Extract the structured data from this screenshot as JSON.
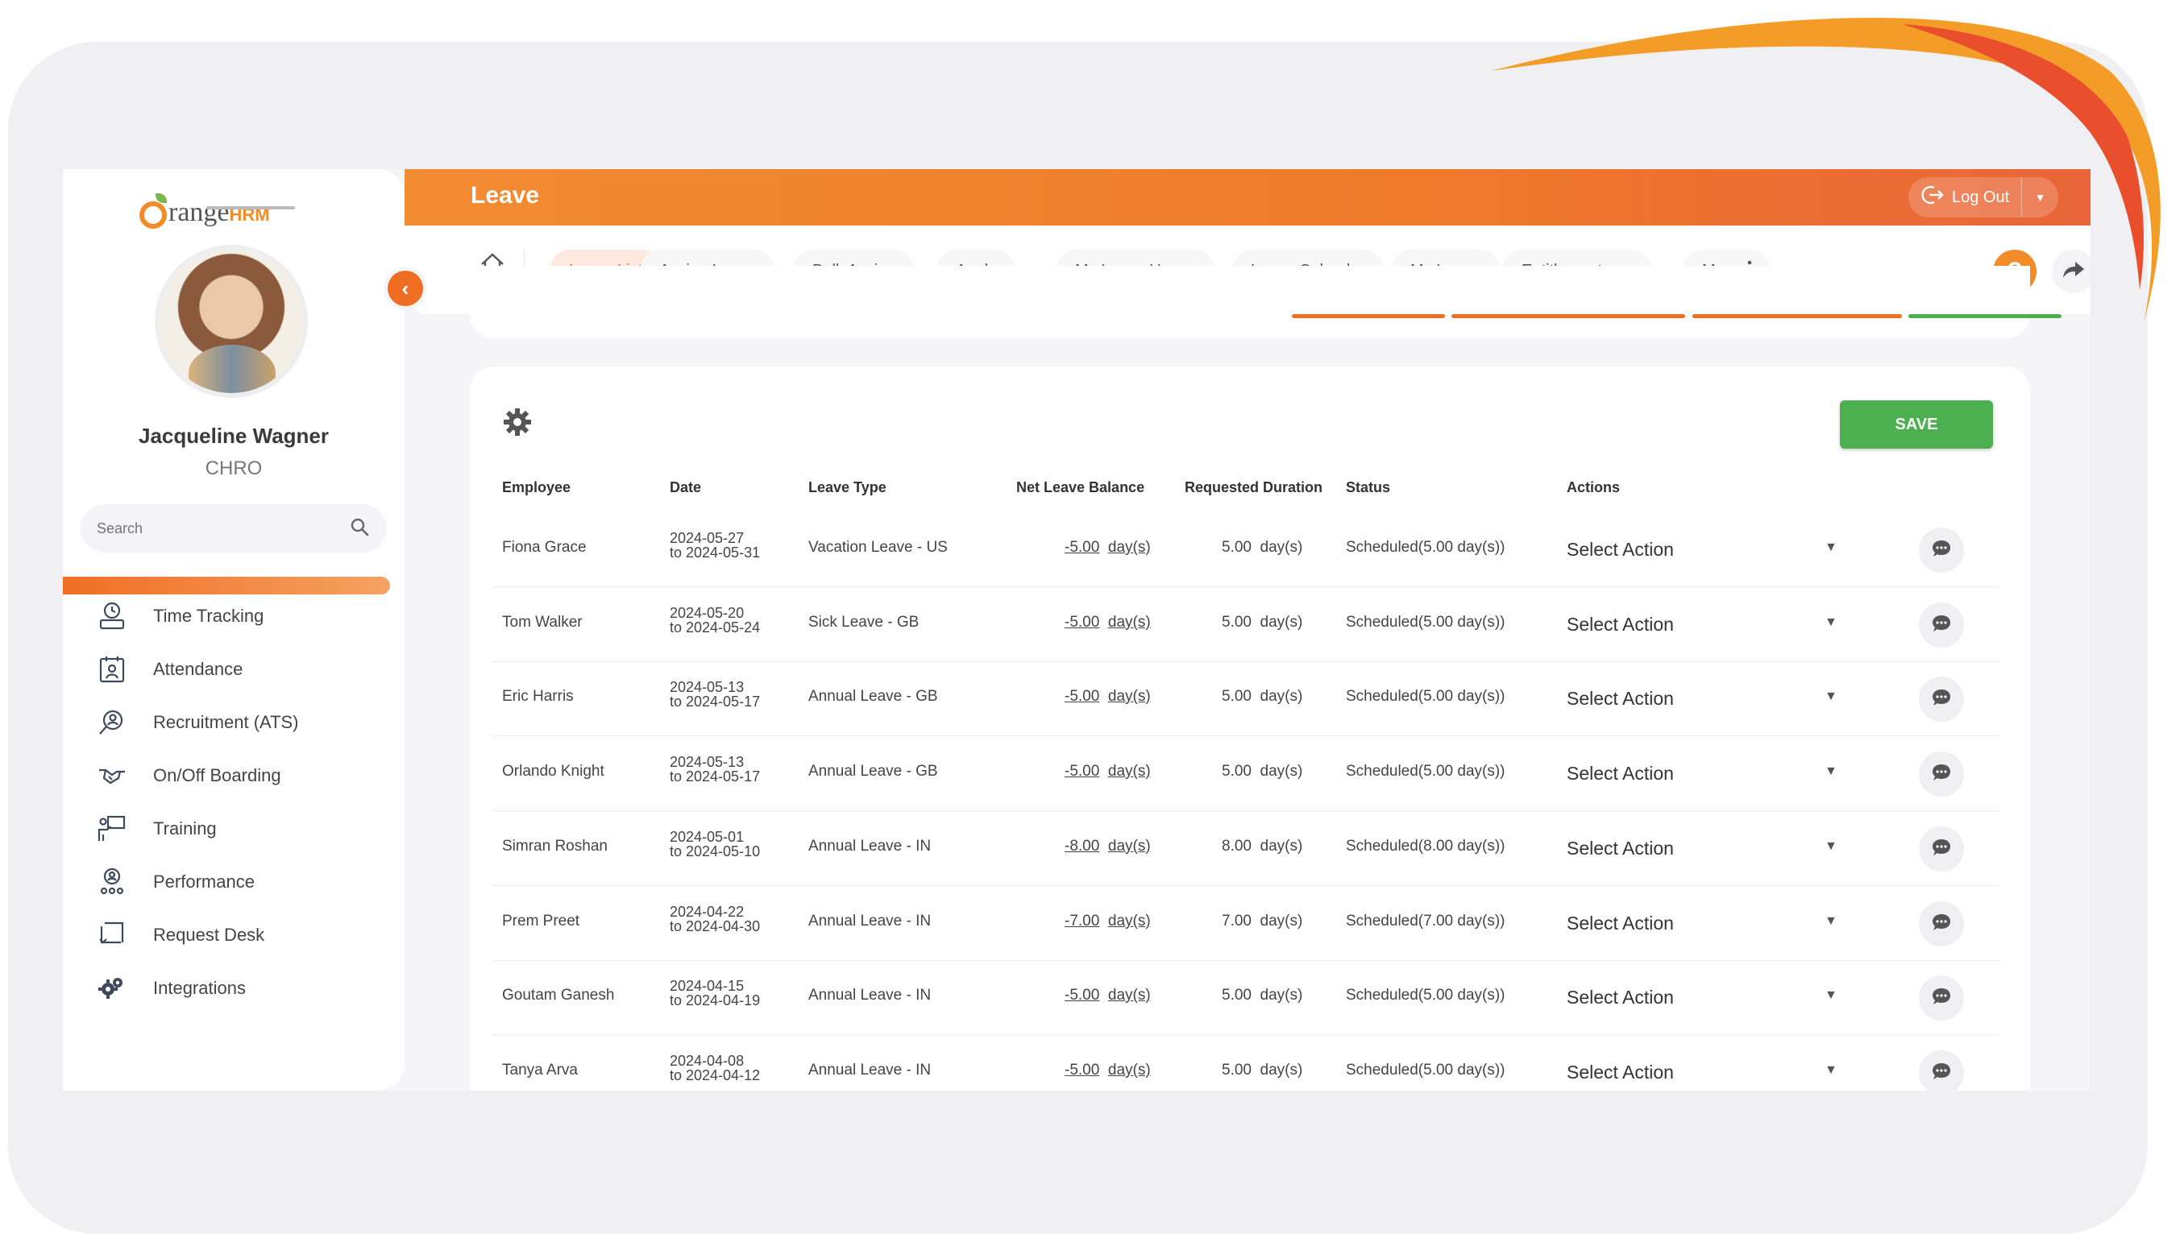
{
  "app": {
    "logo_text": "range",
    "logo_sub": "HRM",
    "module_title": "Leave",
    "logout_label": "Log Out"
  },
  "user": {
    "name": "Jacqueline Wagner",
    "role": "CHRO"
  },
  "search": {
    "placeholder": "Search"
  },
  "sidebar": {
    "items": [
      {
        "label": "Time Tracking",
        "icon": "clock-user-icon"
      },
      {
        "label": "Attendance",
        "icon": "attendance-icon"
      },
      {
        "label": "Recruitment (ATS)",
        "icon": "recruitment-icon"
      },
      {
        "label": "On/Off Boarding",
        "icon": "handshake-icon"
      },
      {
        "label": "Training",
        "icon": "training-icon"
      },
      {
        "label": "Performance",
        "icon": "performance-icon"
      },
      {
        "label": "Request Desk",
        "icon": "request-desk-icon"
      },
      {
        "label": "Integrations",
        "icon": "integrations-icon"
      }
    ]
  },
  "tabs": [
    {
      "label": "Leave List",
      "active": true
    },
    {
      "label": "Assign Leave"
    },
    {
      "label": "Bulk Assign"
    },
    {
      "label": "Apply"
    },
    {
      "label": "My Leave Usage"
    },
    {
      "label": "Leave Calendar"
    },
    {
      "label": "My Leave"
    },
    {
      "label": "Entitlements"
    },
    {
      "label": "More"
    }
  ],
  "table": {
    "save_label": "SAVE",
    "headers": {
      "employee": "Employee",
      "date": "Date",
      "leave_type": "Leave Type",
      "net_balance": "Net Leave Balance",
      "requested": "Requested Duration",
      "status": "Status",
      "actions": "Actions"
    },
    "rows": [
      {
        "employee": "Fiona Grace",
        "date_from": "2024-05-27",
        "date_to": "to 2024-05-31",
        "leave_type": "Vacation Leave - US",
        "balance": "-5.00",
        "balance_unit": "day(s)",
        "duration": "5.00  day(s)",
        "status": "Scheduled(5.00 day(s))",
        "action": "Select Action"
      },
      {
        "employee": "Tom Walker",
        "date_from": "2024-05-20",
        "date_to": "to 2024-05-24",
        "leave_type": "Sick Leave - GB",
        "balance": "-5.00",
        "balance_unit": "day(s)",
        "duration": "5.00  day(s)",
        "status": "Scheduled(5.00 day(s))",
        "action": "Select Action"
      },
      {
        "employee": "Eric Harris",
        "date_from": "2024-05-13",
        "date_to": "to 2024-05-17",
        "leave_type": "Annual Leave - GB",
        "balance": "-5.00",
        "balance_unit": "day(s)",
        "duration": "5.00  day(s)",
        "status": "Scheduled(5.00 day(s))",
        "action": "Select Action"
      },
      {
        "employee": "Orlando Knight",
        "date_from": "2024-05-13",
        "date_to": "to 2024-05-17",
        "leave_type": "Annual Leave - GB",
        "balance": "-5.00",
        "balance_unit": "day(s)",
        "duration": "5.00  day(s)",
        "status": "Scheduled(5.00 day(s))",
        "action": "Select Action"
      },
      {
        "employee": "Simran Roshan",
        "date_from": "2024-05-01",
        "date_to": "to 2024-05-10",
        "leave_type": "Annual Leave - IN",
        "balance": "-8.00",
        "balance_unit": "day(s)",
        "duration": "8.00  day(s)",
        "status": "Scheduled(8.00 day(s))",
        "action": "Select Action"
      },
      {
        "employee": "Prem Preet",
        "date_from": "2024-04-22",
        "date_to": "to 2024-04-30",
        "leave_type": "Annual Leave - IN",
        "balance": "-7.00",
        "balance_unit": "day(s)",
        "duration": "7.00  day(s)",
        "status": "Scheduled(7.00 day(s))",
        "action": "Select Action"
      },
      {
        "employee": "Goutam Ganesh",
        "date_from": "2024-04-15",
        "date_to": "to 2024-04-19",
        "leave_type": "Annual Leave - IN",
        "balance": "-5.00",
        "balance_unit": "day(s)",
        "duration": "5.00  day(s)",
        "status": "Scheduled(5.00 day(s))",
        "action": "Select Action"
      },
      {
        "employee": "Tanya Arva",
        "date_from": "2024-04-08",
        "date_to": "to 2024-04-12",
        "leave_type": "Annual Leave - IN",
        "balance": "-5.00",
        "balance_unit": "day(s)",
        "duration": "5.00  day(s)",
        "status": "Scheduled(5.00 day(s))",
        "action": "Select Action"
      }
    ]
  },
  "colors": {
    "brand_orange": "#f06e24",
    "save_green": "#4caf50",
    "text_dark": "#333333"
  }
}
